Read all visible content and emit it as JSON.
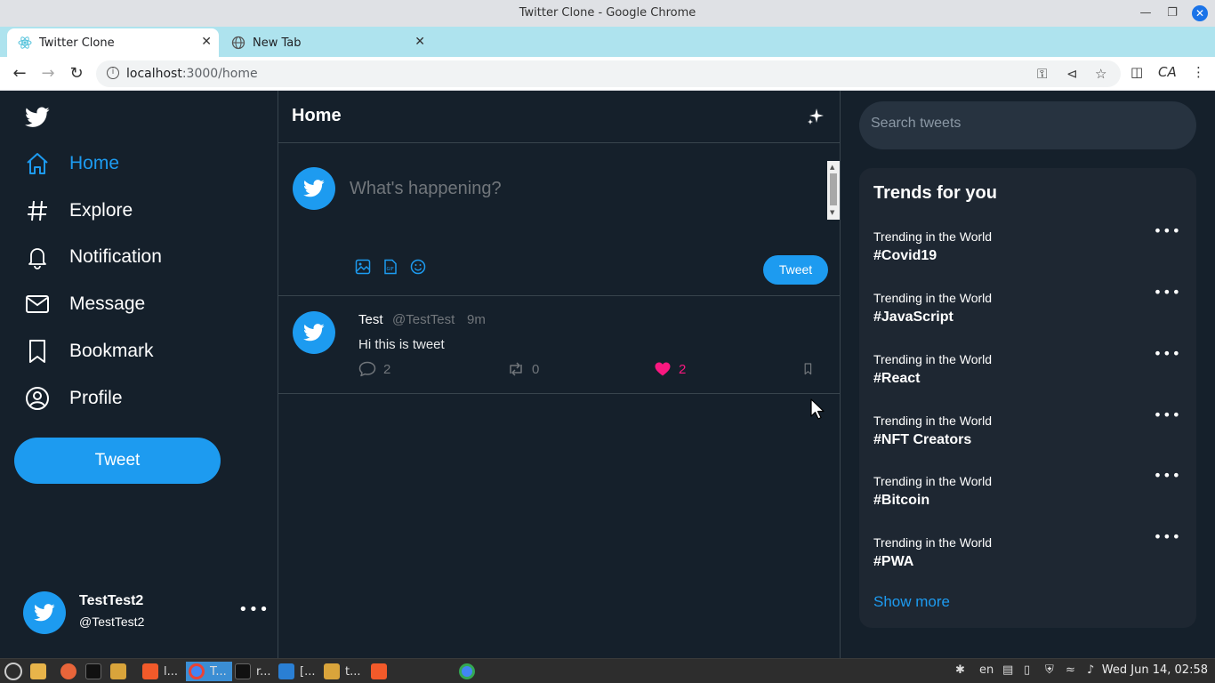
{
  "window": {
    "title": "Twitter Clone - Google Chrome"
  },
  "tabs": [
    {
      "label": "Twitter Clone",
      "active": true
    },
    {
      "label": "New Tab",
      "active": false
    }
  ],
  "address_bar": {
    "url_host": "localhost",
    "url_rest": ":3000/home"
  },
  "sidebar": {
    "items": [
      {
        "label": "Home",
        "icon": "home-icon",
        "active": true
      },
      {
        "label": "Explore",
        "icon": "hashtag-icon"
      },
      {
        "label": "Notification",
        "icon": "bell-icon"
      },
      {
        "label": "Message",
        "icon": "mail-icon"
      },
      {
        "label": "Bookmark",
        "icon": "bookmark-icon"
      },
      {
        "label": "Profile",
        "icon": "user-icon"
      }
    ],
    "tweet_button": "Tweet",
    "profile": {
      "name": "TestTest2",
      "handle": "@TestTest2"
    }
  },
  "feed": {
    "title": "Home",
    "composer": {
      "placeholder": "What's happening?",
      "tweet_button": "Tweet"
    },
    "tweets": [
      {
        "name": "Test",
        "handle": "@TestTest",
        "time": "9m",
        "text": "Hi this is tweet",
        "replies": "2",
        "retweets": "0",
        "likes": "2"
      }
    ]
  },
  "right": {
    "search_placeholder": "Search tweets",
    "trends_title": "Trends for you",
    "trends": [
      {
        "sub": "Trending in the World",
        "tag": "#Covid19"
      },
      {
        "sub": "Trending in the World",
        "tag": "#JavaScript"
      },
      {
        "sub": "Trending in the World",
        "tag": "#React"
      },
      {
        "sub": "Trending in the World",
        "tag": "#NFT Creators"
      },
      {
        "sub": "Trending in the World",
        "tag": "#Bitcoin"
      },
      {
        "sub": "Trending in the World",
        "tag": "#PWA"
      }
    ],
    "show_more": "Show more"
  },
  "taskbar": {
    "apps": [
      "l...",
      "T...",
      "r...",
      "[...",
      "t..."
    ],
    "lang": "en",
    "clock": "Wed Jun 14, 02:58"
  },
  "colors": {
    "accent": "#1d9bf0",
    "bg": "#15202b",
    "like": "#f91880",
    "card": "#1e2732"
  }
}
